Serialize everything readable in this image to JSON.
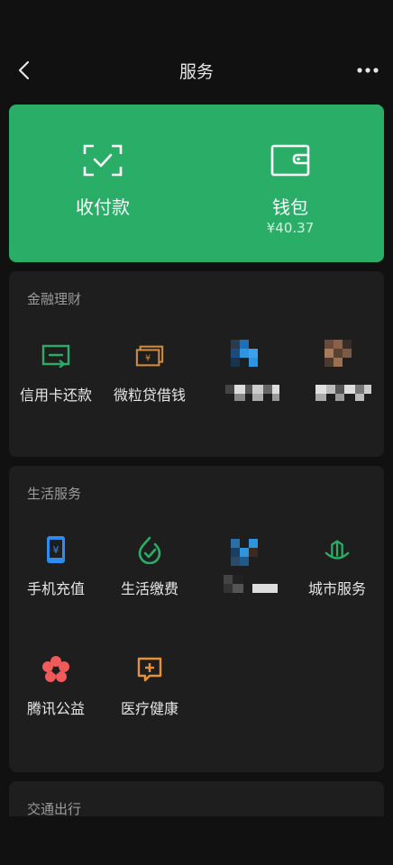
{
  "nav": {
    "title": "服务"
  },
  "hero": {
    "pay": {
      "label": "收付款"
    },
    "wallet": {
      "label": "钱包",
      "balance": "¥40.37"
    }
  },
  "finance": {
    "title": "金融理财",
    "items": [
      {
        "label": "信用卡还款",
        "icon": "card-repay-icon"
      },
      {
        "label": "微粒贷借钱",
        "icon": "loan-money-icon"
      }
    ]
  },
  "life": {
    "title": "生活服务",
    "items": [
      {
        "label": "手机充值",
        "icon": "phone-topup-icon"
      },
      {
        "label": "生活缴费",
        "icon": "utility-pay-icon"
      },
      {
        "label": "城市服务",
        "icon": "city-service-icon"
      },
      {
        "label": "腾讯公益",
        "icon": "charity-flower-icon"
      },
      {
        "label": "医疗健康",
        "icon": "medical-health-icon"
      }
    ]
  },
  "travel": {
    "title": "交通出行"
  },
  "colors": {
    "accent": "#2aae67",
    "bg": "#111111",
    "card": "#1e1e1e"
  }
}
